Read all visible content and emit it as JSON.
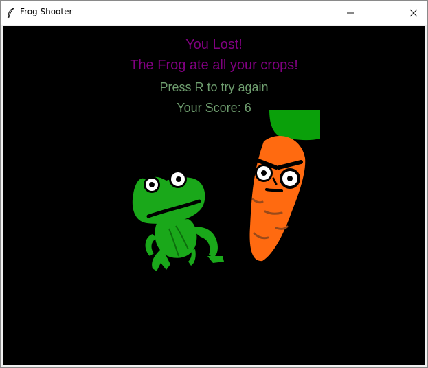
{
  "window": {
    "title": "Frog Shooter",
    "icon": "feather-icon",
    "controls": [
      "minimize-icon",
      "maximize-icon",
      "close-icon"
    ]
  },
  "game": {
    "state": "game-over",
    "lost_text": "You Lost!",
    "reason_text": "The Frog ate all your crops!",
    "retry_text": "Press R to try again",
    "score_text": "Your Score: 6",
    "colors": {
      "background": "#000000",
      "headline": "#800080",
      "info": "#6f9e6f",
      "frog": "#1aa81a",
      "carrot": "#ff6a10",
      "carrot_leaves": "#0aa00a"
    }
  }
}
